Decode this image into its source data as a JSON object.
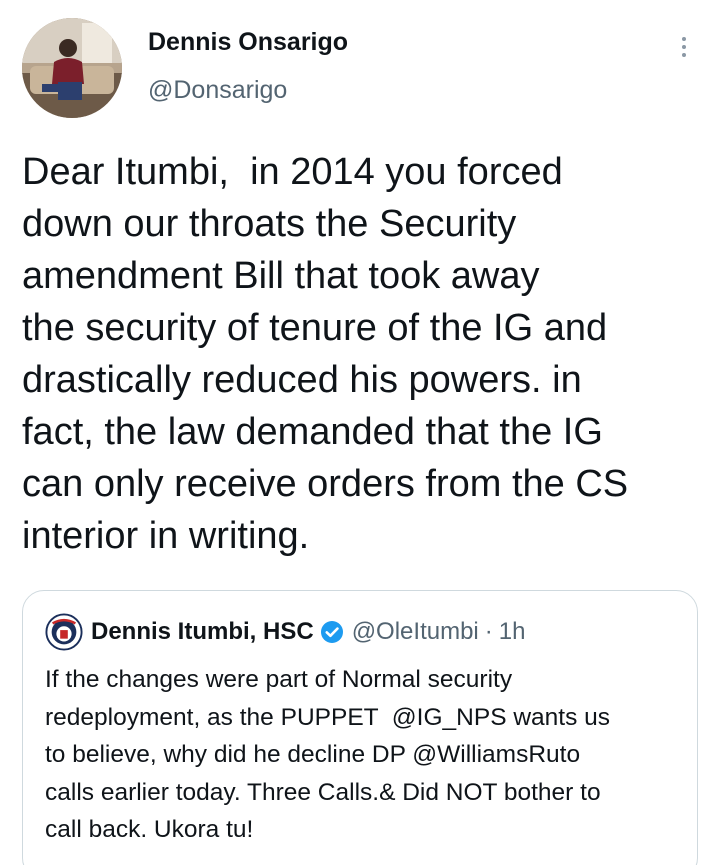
{
  "tweet": {
    "author": {
      "name": "Dennis Onsarigo",
      "handle": "@Donsarigo",
      "avatar": "profile-photo"
    },
    "more_icon": "more-vertical-icon",
    "text_lines": [
      "Dear Itumbi,  in 2014 you forced",
      "down our throats the Security",
      "amendment Bill that took away",
      "the security of tenure of the IG and",
      "drastically reduced his powers. in",
      "fact, the law demanded that the IG",
      "can only receive orders from the CS",
      "interior in writing."
    ]
  },
  "quoted_tweet": {
    "author": {
      "name": "Dennis Itumbi, HSC",
      "verified": true,
      "verified_icon": "verified-badge-icon",
      "handle": "@OleItumbi",
      "separator": "·",
      "time": "1h"
    },
    "text_lines": [
      "If the changes were part of Normal security",
      "redeployment, as the PUPPET  @IG_NPS wants us",
      "to believe, why did he decline DP @WilliamsRuto",
      "calls earlier today. Three Calls.& Did NOT bother to",
      "call back. Ukora tu!"
    ]
  },
  "colors": {
    "text": "#0f1419",
    "secondary": "#536471",
    "border": "#cfd9de",
    "verified": "#1d9bf0"
  }
}
